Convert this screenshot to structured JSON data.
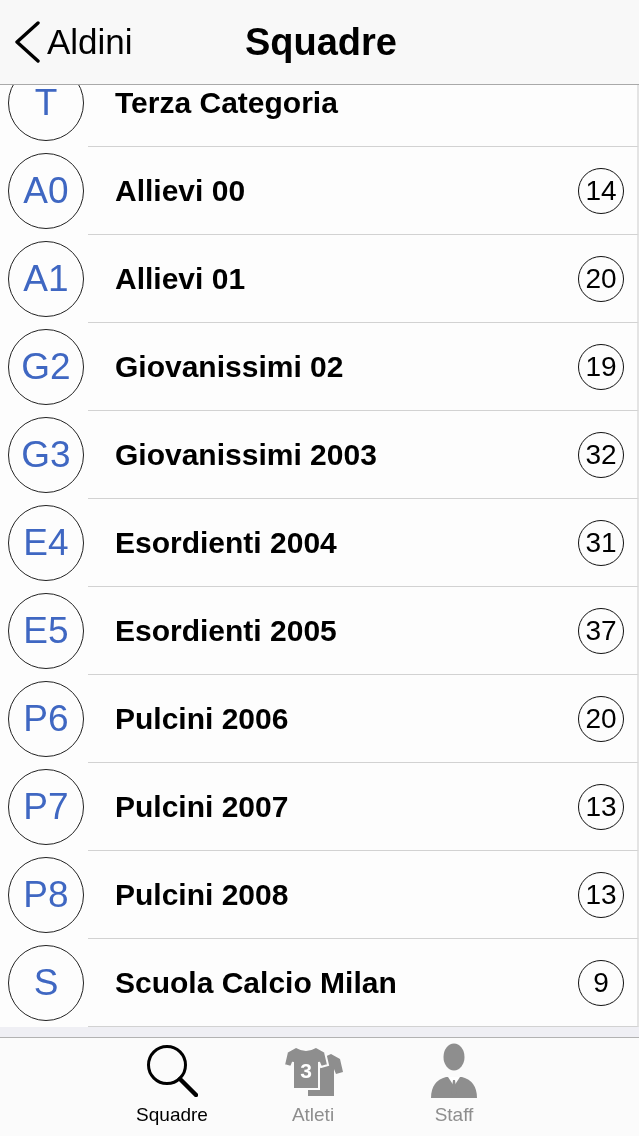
{
  "nav_bar": {
    "back": "Aldini",
    "title": "Squadre"
  },
  "teams": [
    {
      "initials": "T",
      "name": "Terza Categoria"
    },
    {
      "initials": "A0",
      "name": "Allievi 00",
      "count": "14"
    },
    {
      "initials": "A1",
      "name": "Allievi 01",
      "count": "20"
    },
    {
      "initials": "G2",
      "name": "Giovanissimi 02",
      "count": "19"
    },
    {
      "initials": "G3",
      "name": "Giovanissimi 2003",
      "count": "32"
    },
    {
      "initials": "E4",
      "name": "Esordienti 2004",
      "count": "31"
    },
    {
      "initials": "E5",
      "name": "Esordienti 2005",
      "count": "37"
    },
    {
      "initials": "P6",
      "name": "Pulcini 2006",
      "count": "20"
    },
    {
      "initials": "P7",
      "name": "Pulcini 2007",
      "count": "13"
    },
    {
      "initials": "P8",
      "name": "Pulcini 2008",
      "count": "13"
    },
    {
      "initials": "S",
      "name": "Scuola Calcio Milan",
      "count": "9"
    }
  ],
  "tab_bar": [
    {
      "kind": "search",
      "label": "Squadre",
      "selected": true
    },
    {
      "kind": "shirts",
      "label": "Atleti",
      "icon_text": "3",
      "selected": false
    },
    {
      "kind": "person",
      "label": "Staff",
      "selected": false
    }
  ]
}
